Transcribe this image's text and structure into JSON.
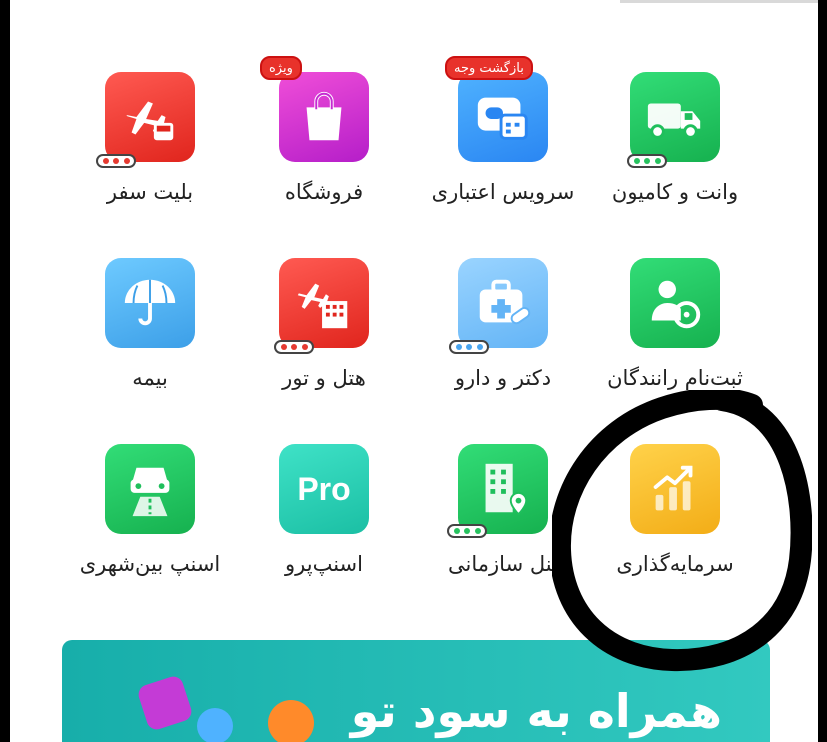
{
  "colors": {
    "accent_teal": "#1bbfa4",
    "badge_red": "#e8322b",
    "annotation_black": "#000000"
  },
  "tiles": [
    {
      "label": "وانت و کامیون",
      "icon": "truck-icon",
      "badge": "",
      "dots": true
    },
    {
      "label": "سرویس اعتباری",
      "icon": "wallet-icon",
      "badge": "بازگشت وجه",
      "dots": false
    },
    {
      "label": "فروشگاه",
      "icon": "shopping-bag-icon",
      "badge": "ویژه",
      "dots": false
    },
    {
      "label": "بلیت سفر",
      "icon": "plane-bus-icon",
      "badge": "",
      "dots": true
    },
    {
      "label": "ثبت‌نام رانندگان",
      "icon": "driver-wheel-icon",
      "badge": "",
      "dots": false
    },
    {
      "label": "دکتر و دارو",
      "icon": "medical-kit-icon",
      "badge": "",
      "dots": true
    },
    {
      "label": "هتل و تور",
      "icon": "plane-hotel-icon",
      "badge": "",
      "dots": true
    },
    {
      "label": "بیمه",
      "icon": "umbrella-icon",
      "badge": "",
      "dots": false
    },
    {
      "label": "سرمایه‌گذاری",
      "icon": "growth-chart-icon",
      "badge": "",
      "dots": false
    },
    {
      "label": "پنل سازمانی",
      "icon": "building-pin-icon",
      "badge": "",
      "dots": true
    },
    {
      "label": "اسنپ‌پرو",
      "icon": "pro-icon",
      "badge": "",
      "dots": false,
      "icon_text": "Pro"
    },
    {
      "label": "اسنپ بین‌شهری",
      "icon": "car-road-icon",
      "badge": "",
      "dots": false
    }
  ],
  "banner": {
    "text": "همراه به سود تو"
  }
}
